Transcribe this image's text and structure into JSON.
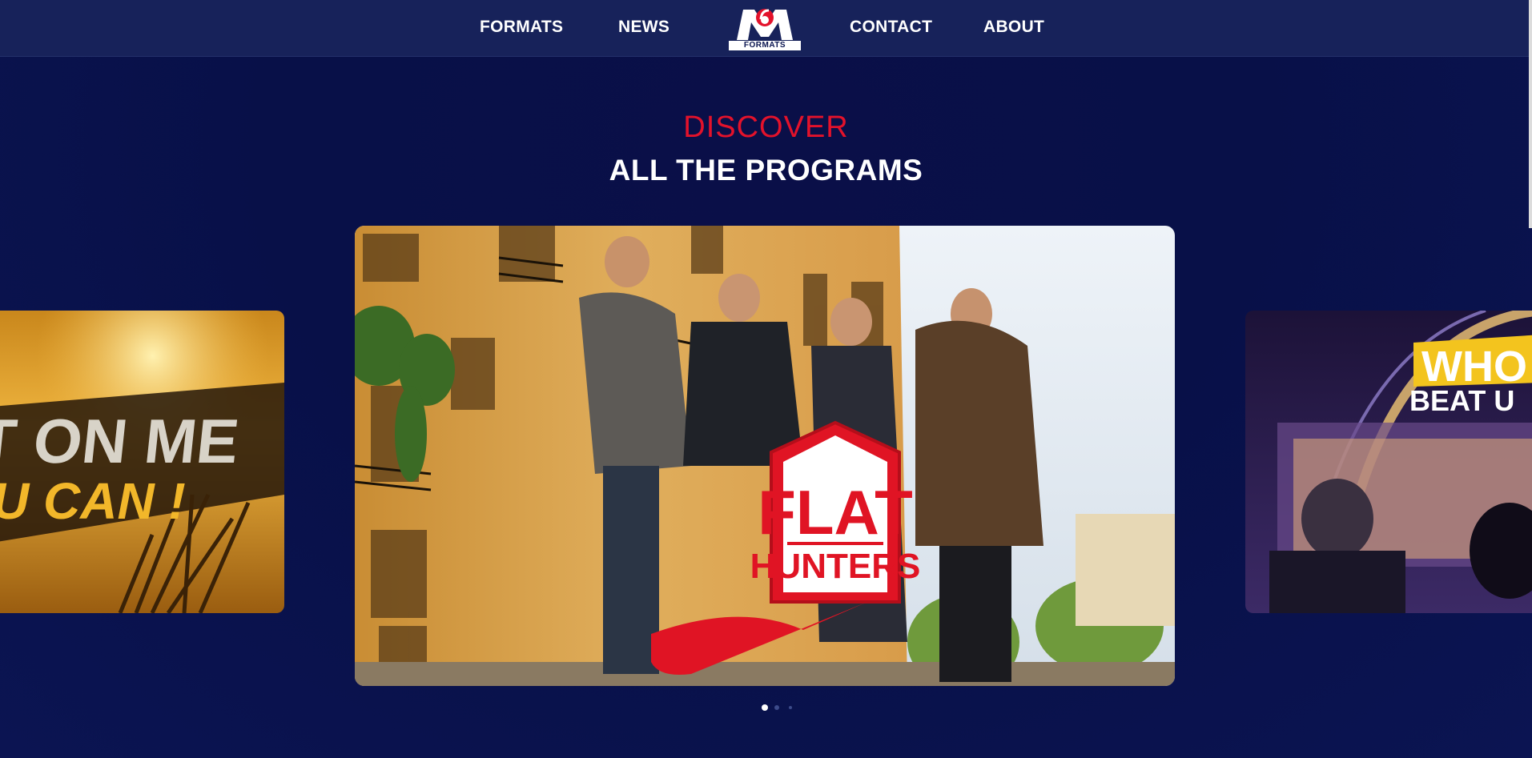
{
  "nav": {
    "left_links": [
      "FORMATS",
      "NEWS"
    ],
    "right_links": [
      "CONTACT",
      "ABOUT"
    ],
    "logo": {
      "mark": "M6",
      "caption": "FORMATS"
    }
  },
  "hero": {
    "kicker": "DISCOVER",
    "title": "ALL THE PROGRAMS"
  },
  "carousel": {
    "slides": [
      {
        "text_line1": "T ON ME",
        "text_line2": "U CAN !"
      },
      {
        "logo_line1": "FLAT",
        "logo_line2": "HUNTERS"
      },
      {
        "text_line1": "WHO",
        "text_line2": "BEAT U"
      }
    ],
    "active_index": 1,
    "dot_count": 3
  },
  "colors": {
    "accent_red": "#e3122b",
    "nav_bg": "#17225a",
    "page_bg": "#081048"
  }
}
